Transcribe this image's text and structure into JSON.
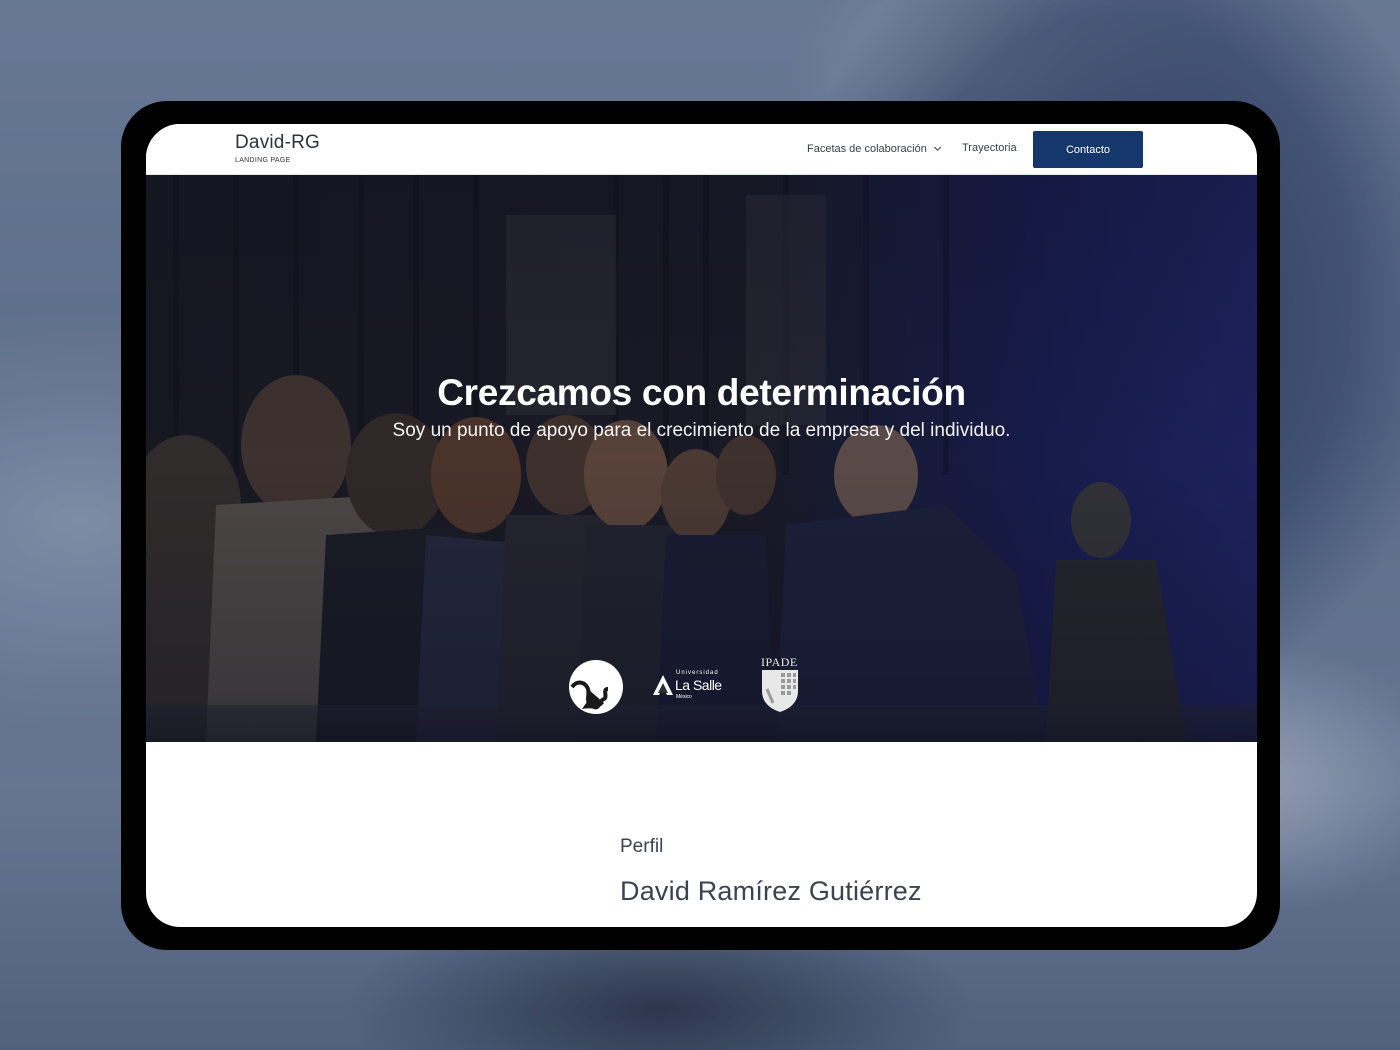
{
  "brand": {
    "title": "David-RG",
    "subtitle": "LANDING PAGE"
  },
  "nav": {
    "facetas_label": "Facetas de colaboración",
    "trayectoria_label": "Trayectoria",
    "contacto_label": "Contacto"
  },
  "hero": {
    "title": "Crezcamos con determinación",
    "subtitle": "Soy un punto de apoyo para el crecimiento de la empresa y del individuo.",
    "logos": {
      "lasalle_small": "Universidad",
      "lasalle_name": "La Salle",
      "lasalle_city": "México",
      "ipade": "IPADE"
    }
  },
  "perfil": {
    "label": "Perfil",
    "name": "David Ramírez Gutiérrez"
  },
  "colors": {
    "accent": "#16376b",
    "text_dark": "#3b4350",
    "frame": "#000000"
  },
  "icons": [
    "logo-circle-icon",
    "lasalle-logo-icon",
    "ipade-shield-icon",
    "chevron-down-icon"
  ]
}
